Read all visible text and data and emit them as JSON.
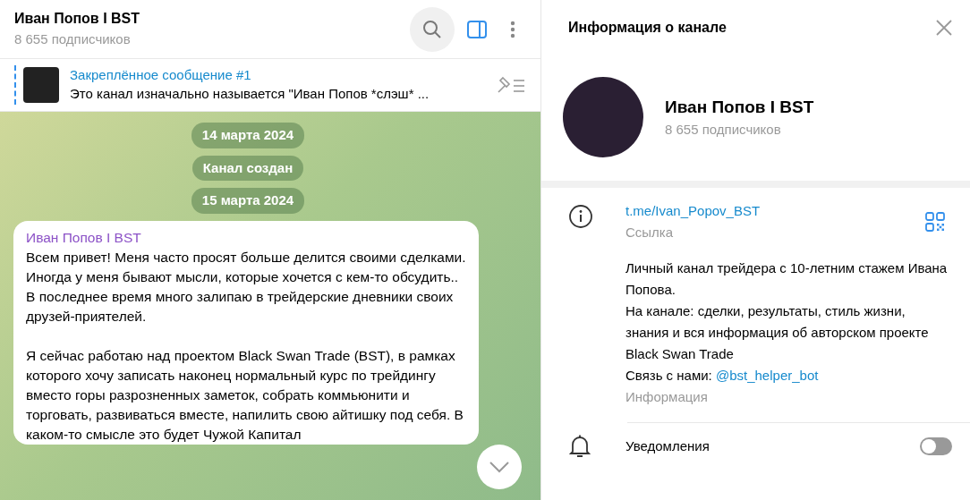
{
  "chat": {
    "title": "Иван Попов I BST",
    "subtitle": "8 655 подписчиков",
    "pinned": {
      "title": "Закреплённое сообщение #1",
      "text": "Это канал изначально называется \"Иван Попов *слэш* ..."
    },
    "service": [
      {
        "text": "14 марта 2024"
      },
      {
        "text": "Канал создан"
      },
      {
        "text": "15 марта 2024"
      }
    ],
    "message": {
      "author": "Иван Попов I BST",
      "paragraphs": [
        "Всем привет!  Меня часто просят больше делится своими сделками.\nИногда у меня бывают мысли, которые хочется с кем-то обсудить..\nВ последнее время много залипаю в трейдерские дневники своих друзей-приятелей.",
        "Я сейчас работаю над проектом Black Swan Trade (BST), в рамках которого хочу записать наконец нормальный курс по трейдингу вместо горы разрозненных заметок, собрать коммьюнити и торговать, развиваться вместе, напилить свою айтишку под себя. В каком-то смысле это будет Чужой Капитал"
      ]
    }
  },
  "info": {
    "title": "Информация о канале",
    "name": "Иван Попов I BST",
    "subtitle": "8 655 подписчиков",
    "link": "t.me/Ivan_Popov_BST",
    "link_label": "Ссылка",
    "description": "Личный канал трейдера с 10-летним стажем Ивана Попова.\nНа канале: сделки, результаты, стиль жизни, знания и вся информация об авторском проекте Black Swan Trade",
    "contact_label": "Связь с нами:",
    "contact_link": "@bst_helper_bot",
    "description_label": "Информация",
    "notifications": {
      "label": "Уведомления",
      "on": false
    }
  }
}
